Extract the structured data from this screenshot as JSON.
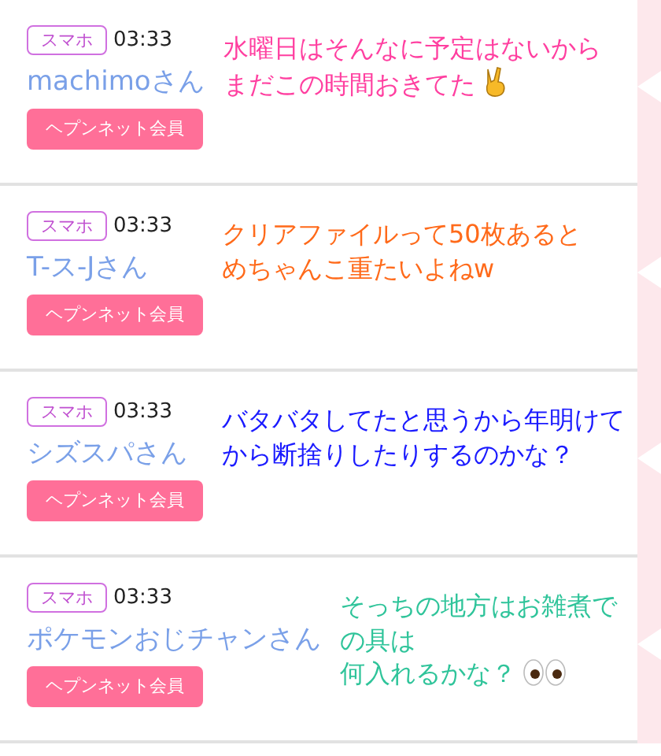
{
  "posts": [
    {
      "badge": "スマホ",
      "time": "03:33",
      "name": "machimoさん",
      "member_button": "ヘプンネット会員",
      "caption": {
        "color": "#ff3fa0",
        "lines": [
          "水曜日はそんなに予定はないから",
          "まだこの時間おきてた"
        ],
        "end_mark": {
          "kind": "hand"
        }
      }
    },
    {
      "badge": "スマホ",
      "time": "03:33",
      "name": "T-ス-Jさん",
      "member_button": "ヘプンネット会員",
      "caption": {
        "color": "#ff6a1a",
        "lines": [
          "クリアファイルって50枚あると",
          "めちゃんこ重たいよねw"
        ]
      }
    },
    {
      "badge": "スマホ",
      "time": "03:33",
      "name": "シズスパさん",
      "member_button": "ヘプンネット会員",
      "caption": {
        "color": "#1a1aff",
        "lines": [
          "バタバタしてたと思うから年明けて",
          "から断捨りしたりするのかな？"
        ]
      }
    },
    {
      "badge": "スマホ",
      "time": "03:33",
      "name": "ポケモンおじチャンさん",
      "member_button": "ヘプンネット会員",
      "caption": {
        "color": "#2fc49a",
        "lines": [
          "そっちの地方はお雑煮での具は",
          "何入れるかな？"
        ],
        "end_mark": {
          "kind": "eyes"
        }
      }
    }
  ]
}
